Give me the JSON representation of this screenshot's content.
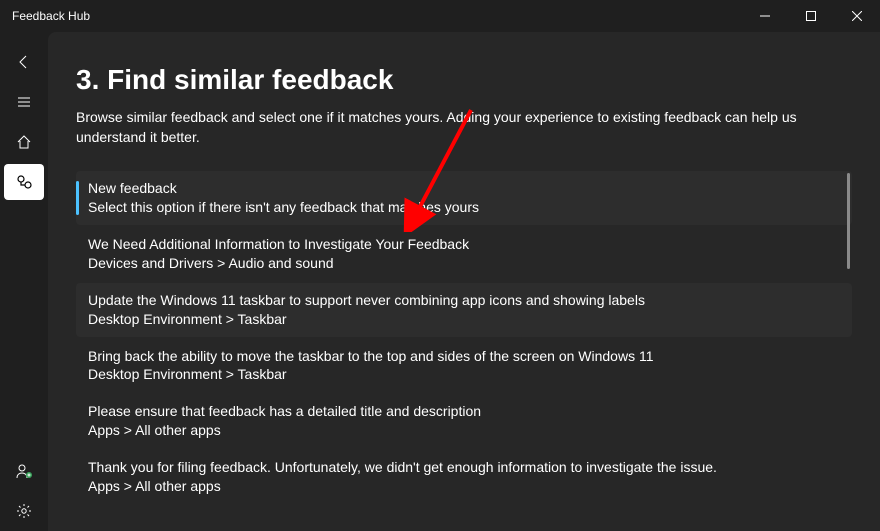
{
  "window": {
    "title": "Feedback Hub"
  },
  "nav": {
    "back": "Back",
    "menu": "Menu",
    "home": "Home",
    "feedback": "Feedback",
    "add_user": "Add user",
    "settings": "Settings"
  },
  "page": {
    "title": "3. Find similar feedback",
    "intro": "Browse similar feedback and select one if it matches yours. Adding your experience to existing feedback can help us understand it better."
  },
  "items": [
    {
      "title": "New feedback",
      "sub": "Select this option if there isn't any feedback that matches yours"
    },
    {
      "title": "We Need Additional Information to Investigate Your Feedback",
      "sub": "Devices and Drivers > Audio and sound"
    },
    {
      "title": "Update the Windows 11 taskbar to support never combining app icons and showing labels",
      "sub": "Desktop Environment > Taskbar"
    },
    {
      "title": "Bring back the ability to move the taskbar to the top and sides of the screen on Windows 11",
      "sub": "Desktop Environment > Taskbar"
    },
    {
      "title": "Please ensure that feedback has a detailed title and description",
      "sub": "Apps > All other apps"
    },
    {
      "title": "Thank you for filing feedback. Unfortunately, we didn't get enough information to investigate the issue.",
      "sub": "Apps > All other apps"
    }
  ]
}
